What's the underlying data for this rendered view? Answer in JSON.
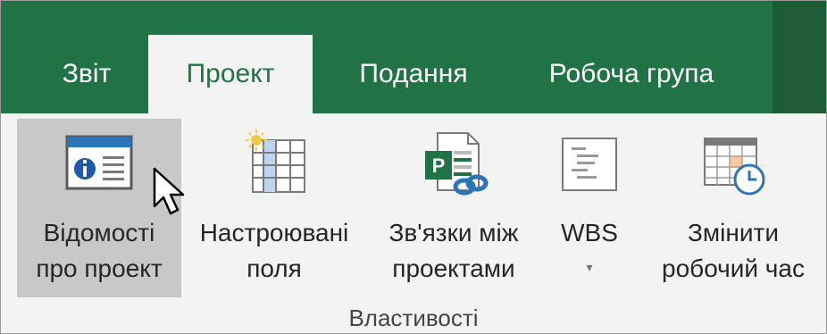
{
  "tabs": [
    {
      "label": "Звіт",
      "active": false
    },
    {
      "label": "Проект",
      "active": true
    },
    {
      "label": "Подання",
      "active": false
    },
    {
      "label": "Робоча група",
      "active": false
    }
  ],
  "ribbon": {
    "group_label": "Властивості",
    "commands": [
      {
        "line1": "Відомості",
        "line2": "про проект",
        "icon": "project-information-icon"
      },
      {
        "line1": "Настроювані",
        "line2": "поля",
        "icon": "custom-fields-icon"
      },
      {
        "line1": "Зв'язки між",
        "line2": "проектами",
        "icon": "links-between-projects-icon"
      },
      {
        "line1": "WBS",
        "line2": "▾",
        "icon": "wbs-icon"
      },
      {
        "line1": "Змінити",
        "line2": "робочий час",
        "icon": "change-working-time-icon"
      }
    ]
  },
  "colors": {
    "ribbon_accent": "#217346",
    "hover": "#c8c8c8"
  }
}
